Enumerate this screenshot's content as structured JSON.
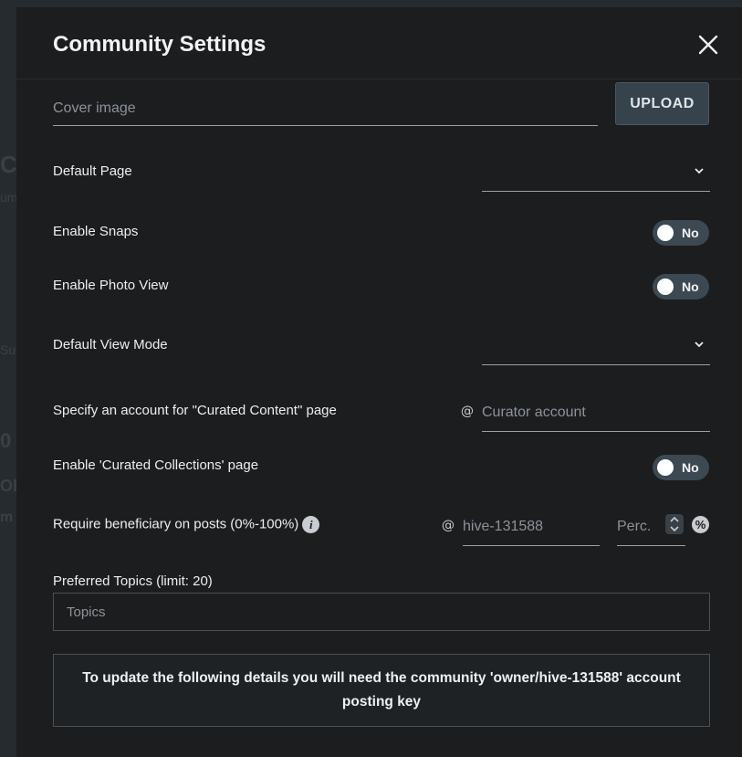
{
  "modal": {
    "title": "Community Settings",
    "close_icon": "close-icon"
  },
  "cover_image": {
    "placeholder": "Cover image",
    "upload_label": "UPLOAD"
  },
  "default_page": {
    "label": "Default Page",
    "value": ""
  },
  "enable_snaps": {
    "label": "Enable Snaps",
    "state": "No"
  },
  "enable_photo_view": {
    "label": "Enable Photo View",
    "state": "No"
  },
  "default_view_mode": {
    "label": "Default View Mode",
    "value": ""
  },
  "curated_content": {
    "label": "Specify an account for \"Curated Content\" page",
    "placeholder": "Curator account"
  },
  "curated_collections": {
    "label": "Enable 'Curated Collections' page",
    "state": "No"
  },
  "beneficiary": {
    "label": "Require beneficiary on posts (0%-100%)",
    "account_placeholder": "hive-131588",
    "percent_placeholder": "Perc."
  },
  "preferred_topics": {
    "label": "Preferred Topics (limit: 20)",
    "placeholder": "Topics"
  },
  "notice": {
    "text": "To update the following details you will need the community 'owner/hive-131588' account posting key"
  },
  "colors": {
    "modal_bg": "#1b1d1f",
    "toggle_bg": "#3c4852",
    "upload_bg": "#36434d"
  }
}
